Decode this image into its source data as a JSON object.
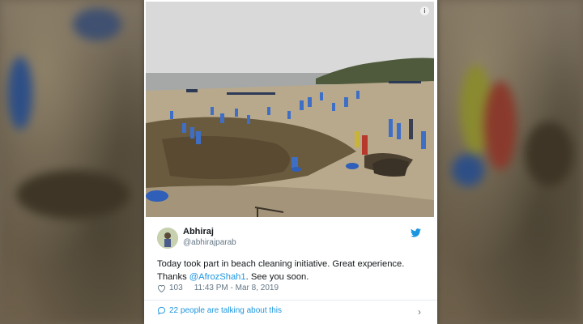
{
  "tweet": {
    "author_name": "Abhiraj",
    "author_handle": "@abhirajparab",
    "text_before_mention": "Today took part in beach cleaning initiative. Great experience. Thanks ",
    "mention": "@AfrozShah1",
    "text_after_mention": ". See you soon.",
    "likes": "103",
    "timestamp": "11:43 PM - Mar 8, 2019",
    "talking_label": "22 people are talking about this"
  },
  "colors": {
    "twitter_blue": "#1b95e0",
    "secondary_text": "#657786",
    "primary_text": "#14171a"
  },
  "icons": {
    "info": "info-icon",
    "bird": "twitter-bird-icon",
    "like": "heart-icon",
    "reply": "speech-bubble-icon",
    "chevron": "chevron-right-icon"
  }
}
